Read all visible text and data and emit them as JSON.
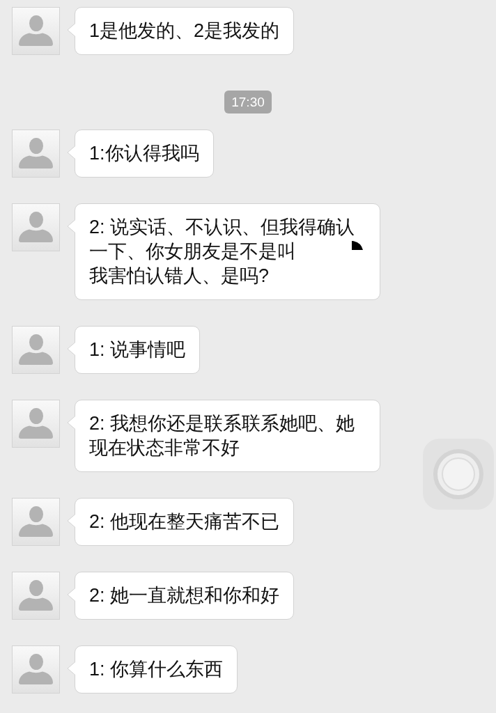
{
  "messages": [
    {
      "kind": "text",
      "lines": [
        "1是他发的、2是我发的"
      ],
      "redacted": false
    },
    {
      "kind": "time",
      "text": "17:30"
    },
    {
      "kind": "text",
      "lines": [
        "1:你认得我吗"
      ],
      "redacted": false
    },
    {
      "kind": "text",
      "lines": [
        "2: 说实话、不认识、但我得确认",
        "一下、你女朋友是不是叫",
        "我害怕认错人、是吗?"
      ],
      "redacted": true
    },
    {
      "kind": "text",
      "lines": [
        "1: 说事情吧"
      ],
      "redacted": false
    },
    {
      "kind": "text",
      "lines": [
        "2: 我想你还是联系联系她吧、她",
        "现在状态非常不好"
      ],
      "redacted": false
    },
    {
      "kind": "text",
      "lines": [
        "2: 他现在整天痛苦不已"
      ],
      "redacted": false
    },
    {
      "kind": "text",
      "lines": [
        "2: 她一直就想和你和好"
      ],
      "redacted": false
    },
    {
      "kind": "text",
      "lines": [
        "1: 你算什么东西"
      ],
      "redacted": false
    }
  ]
}
